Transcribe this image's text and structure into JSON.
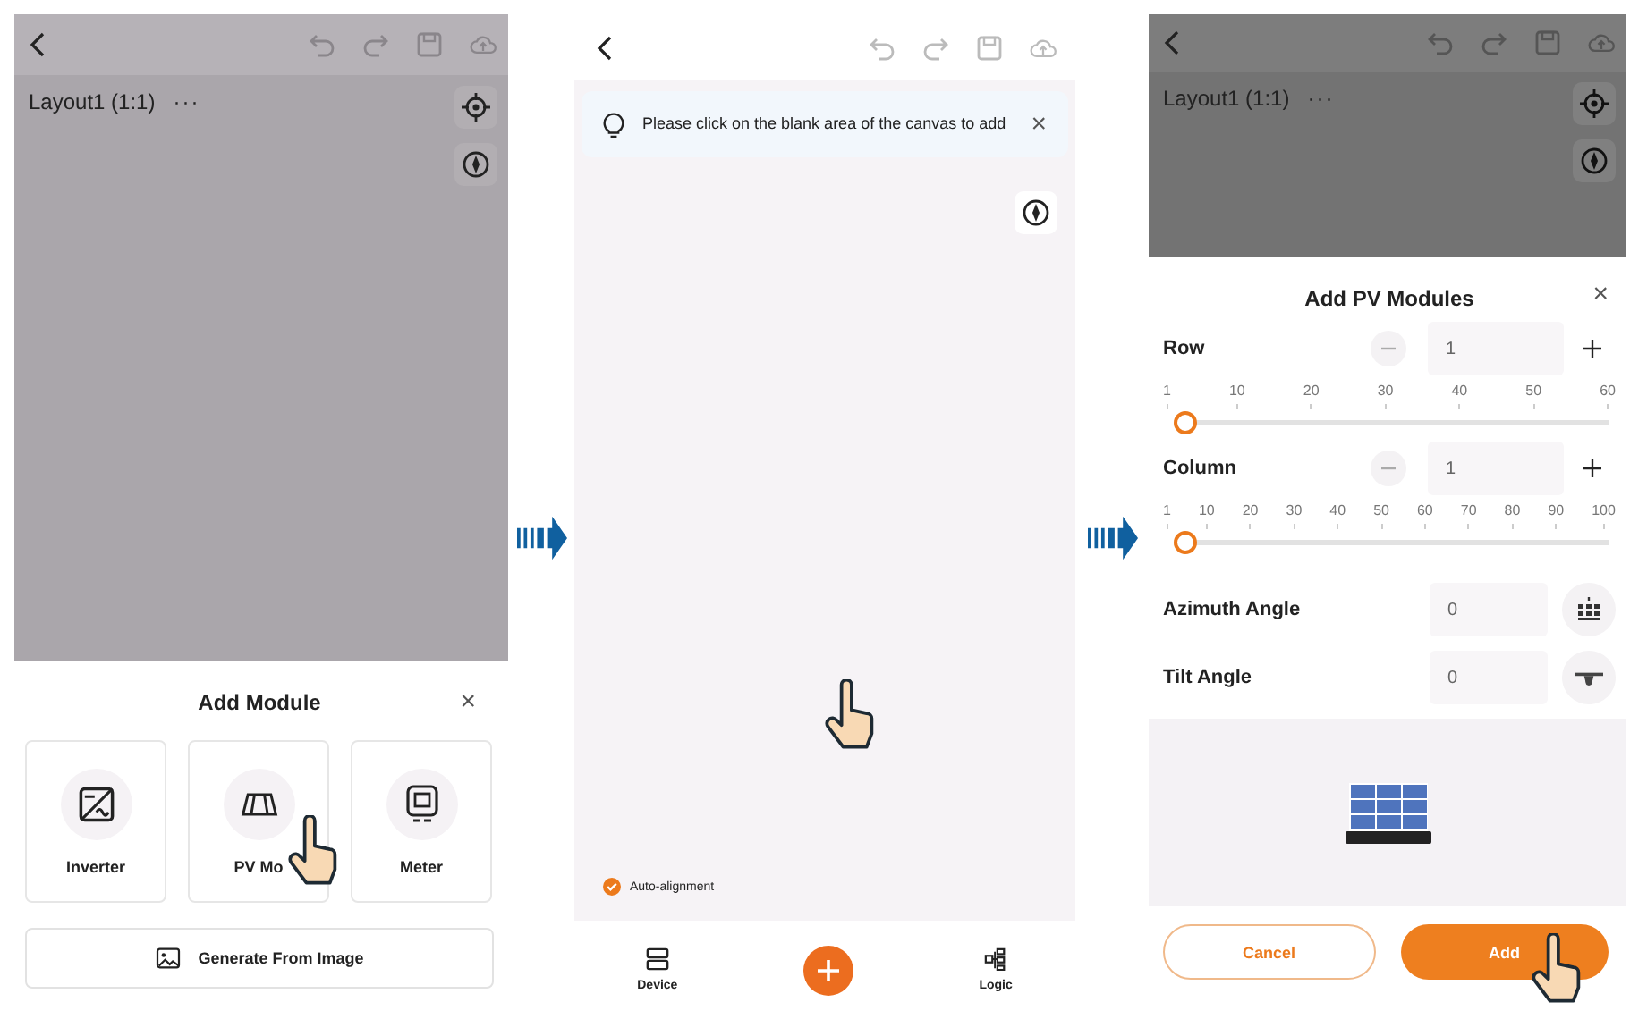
{
  "add_module_screen": {
    "layout_name": "Layout1 (1:1)",
    "more": "···",
    "sheet": {
      "title": "Add Module",
      "close": "×",
      "options": [
        {
          "label": "Inverter",
          "kind": "inverter"
        },
        {
          "label": "PV Mo",
          "kind": "pv"
        },
        {
          "label": "Meter",
          "kind": "meter"
        }
      ],
      "generate_button": "Generate From Image"
    }
  },
  "placement_screen": {
    "tip": "Please click on the blank area of the canvas to add",
    "tip_close": "×",
    "auto_alignment": {
      "label": "Auto-alignment",
      "checked": true
    },
    "nav": [
      {
        "label": "Device",
        "kind": "device"
      },
      {
        "kind": "add"
      },
      {
        "label": "Logic",
        "kind": "logic"
      }
    ]
  },
  "pv_modules_screen": {
    "layout_name": "Layout1 (1:1)",
    "more": "···",
    "sheet": {
      "title": "Add PV Modules",
      "close": "×",
      "counters": [
        {
          "label": "Row",
          "value": "1",
          "ticks": [
            "1",
            "10",
            "20",
            "30",
            "40",
            "50",
            "60"
          ],
          "level": 0
        },
        {
          "label": "Column",
          "value": "1",
          "ticks": [
            "1",
            "10",
            "20",
            "30",
            "40",
            "50",
            "60",
            "70",
            "80",
            "90",
            "100"
          ],
          "level": 0
        }
      ],
      "angles": [
        {
          "label": "Azimuth Angle",
          "value": "0",
          "kind": "azimuth"
        },
        {
          "label": "Tilt Angle",
          "value": "0",
          "kind": "tilt"
        }
      ],
      "cancel": "Cancel",
      "add": "Add"
    }
  }
}
